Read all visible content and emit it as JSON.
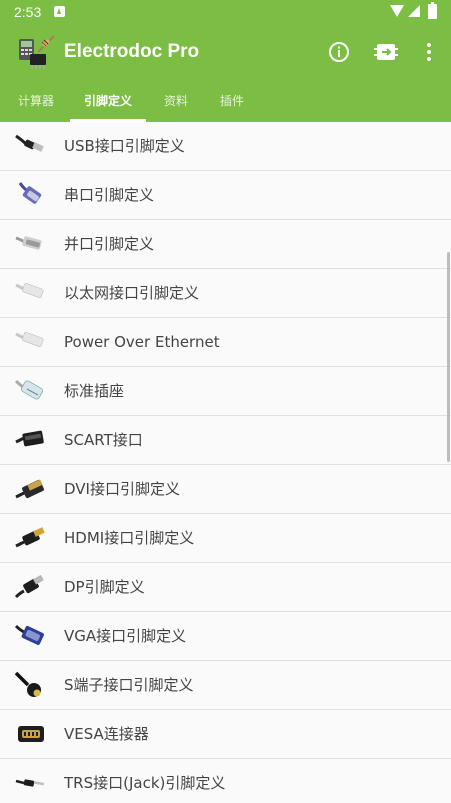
{
  "status": {
    "time": "2:53"
  },
  "app": {
    "title": "Electrodoc Pro"
  },
  "actions": {
    "info": "info-icon",
    "pin": "pin-icon",
    "more": "more-vert-icon"
  },
  "tabs": [
    {
      "label": "计算器"
    },
    {
      "label": "引脚定义"
    },
    {
      "label": "资料"
    },
    {
      "label": "插件"
    }
  ],
  "items": [
    {
      "label": "USB接口引脚定义",
      "icon": "usb-cable-icon"
    },
    {
      "label": "串口引脚定义",
      "icon": "serial-port-icon"
    },
    {
      "label": "并口引脚定义",
      "icon": "parallel-port-icon"
    },
    {
      "label": "以太网接口引脚定义",
      "icon": "ethernet-plug-icon"
    },
    {
      "label": "Power Over Ethernet",
      "icon": "poe-plug-icon"
    },
    {
      "label": "标准插座",
      "icon": "standard-socket-icon"
    },
    {
      "label": "SCART接口",
      "icon": "scart-plug-icon"
    },
    {
      "label": "DVI接口引脚定义",
      "icon": "dvi-plug-icon"
    },
    {
      "label": "HDMI接口引脚定义",
      "icon": "hdmi-plug-icon"
    },
    {
      "label": "DP引脚定义",
      "icon": "displayport-plug-icon"
    },
    {
      "label": "VGA接口引脚定义",
      "icon": "vga-plug-icon"
    },
    {
      "label": "S端子接口引脚定义",
      "icon": "s-video-plug-icon"
    },
    {
      "label": "VESA连接器",
      "icon": "vesa-connector-icon"
    },
    {
      "label": "TRS接口(Jack)引脚定义",
      "icon": "trs-jack-icon"
    }
  ],
  "colors": {
    "primary": "#7cbe43",
    "text": "#444444",
    "divider": "#e0e0e0"
  }
}
